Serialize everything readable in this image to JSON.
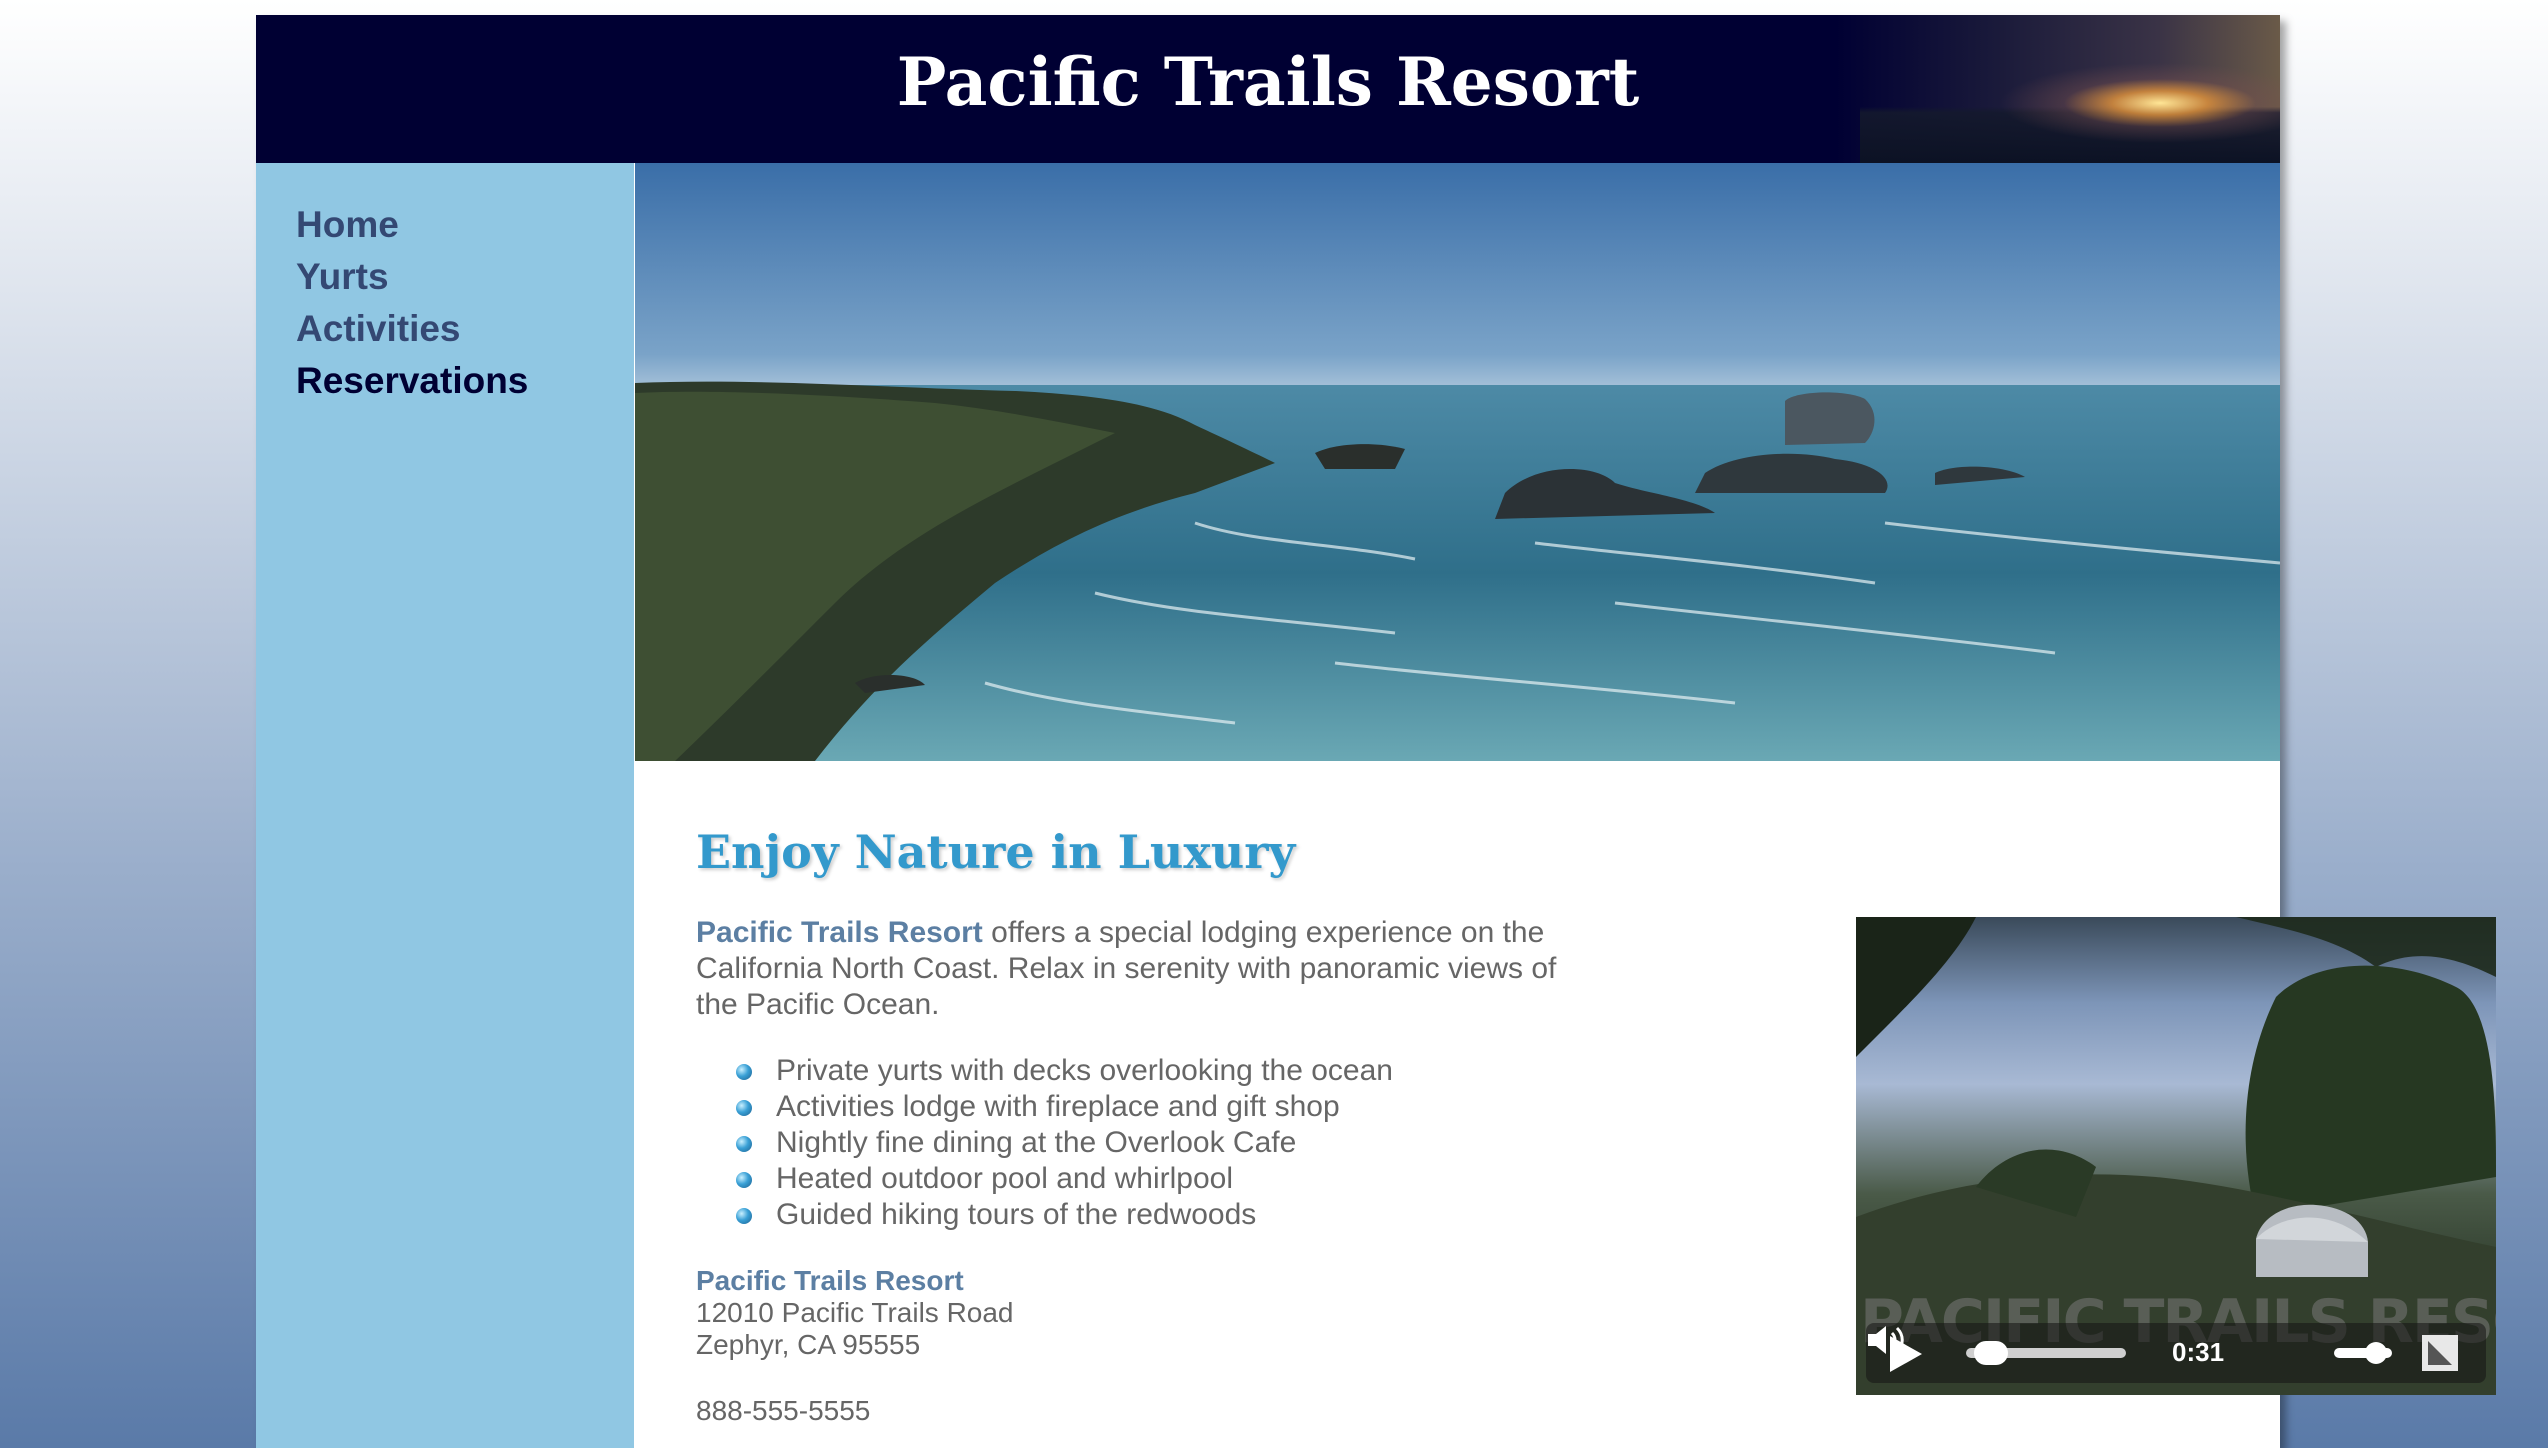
{
  "header": {
    "title": "Pacific Trails Resort"
  },
  "nav": {
    "items": [
      {
        "label": "Home",
        "current": false
      },
      {
        "label": "Yurts",
        "current": false
      },
      {
        "label": "Activities",
        "current": false
      },
      {
        "label": "Reservations",
        "current": true
      }
    ]
  },
  "main": {
    "heading": "Enjoy Nature in Luxury",
    "intro": {
      "resort_name": "Pacific Trails Resort",
      "text": " offers a special lodging experience on the California North Coast. Relax in serenity with panoramic views of the Pacific Ocean."
    },
    "features": [
      "Private yurts with decks overlooking the ocean",
      "Activities lodge with fireplace and gift shop",
      "Nightly fine dining at the Overlook Cafe",
      "Heated outdoor pool and whirlpool",
      "Guided hiking tours of the redwoods"
    ],
    "address": {
      "name": "Pacific Trails Resort",
      "street": "12010 Pacific Trails Road",
      "city": "Zephyr, CA 95555"
    },
    "phone": "888-555-5555"
  },
  "video": {
    "watermark": "PACIFIC TRAILS RESORT",
    "time": "0:31",
    "progress": 0.06,
    "volume": 0.85
  },
  "colors": {
    "header_bg": "#000033",
    "nav_bg": "#90c7e3",
    "nav_link": "#344873",
    "nav_current": "#000033",
    "heading": "#3399cc",
    "resort_name": "#5c7fa3",
    "text": "#666666"
  }
}
